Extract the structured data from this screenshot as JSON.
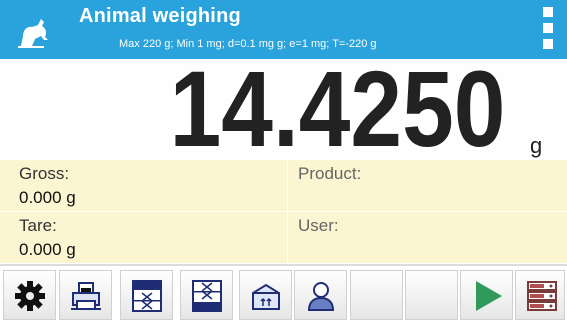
{
  "header": {
    "title": "Animal weighing",
    "subtitle": "Max 220 g; Min 1 mg; d=0.1 mg g; e=1 mg; T=-220 g",
    "mode_icon": "animal-icon",
    "menu_icon": "more-vertical-icon"
  },
  "display": {
    "reading": "14.4250",
    "unit": "g"
  },
  "info": {
    "gross_label": "Gross:",
    "gross_value": "0.000 g",
    "tare_label": "Tare:",
    "tare_value": "0.000 g",
    "product_label": "Product:",
    "product_value": "",
    "user_label": "User:",
    "user_value": ""
  },
  "toolbar": {
    "buttons": [
      {
        "icon": "settings-gear-icon"
      },
      {
        "icon": "printer-icon"
      },
      {
        "icon": "checkweighing-low-icon"
      },
      {
        "icon": "checkweighing-high-icon"
      },
      {
        "icon": "tare-container-icon"
      },
      {
        "icon": "user-icon"
      },
      {
        "icon": "empty-slot"
      },
      {
        "icon": "empty-slot"
      },
      {
        "icon": "start-play-icon"
      },
      {
        "icon": "database-icon"
      }
    ]
  },
  "colors": {
    "header_bg": "#2aa2dc",
    "info_bg": "#fcf5d2",
    "play_green": "#2f9a5a",
    "icon_navy": "#1f2d74"
  }
}
